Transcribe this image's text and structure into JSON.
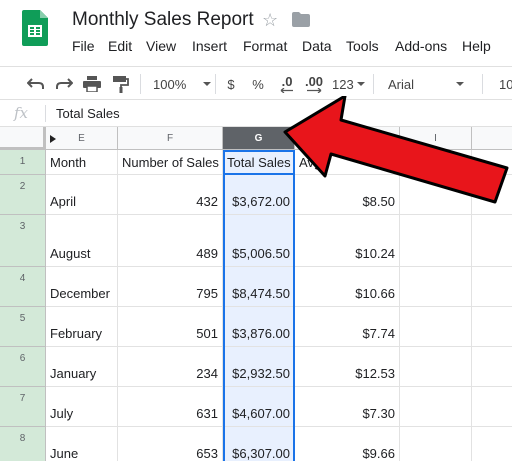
{
  "header": {
    "title": "Monthly Sales Report",
    "menu": [
      "File",
      "Edit",
      "View",
      "Insert",
      "Format",
      "Data",
      "Tools",
      "Add-ons",
      "Help"
    ]
  },
  "toolbar": {
    "zoom": "100%",
    "currency": "$",
    "percent": "%",
    "decrease_decimals": ".0",
    "increase_decimals": ".00",
    "more_formats": "123",
    "font": "Arial",
    "font_size": "10"
  },
  "formula_bar": {
    "fx": "fx",
    "value": "Total Sales"
  },
  "grid": {
    "columns": [
      "E",
      "F",
      "G",
      "H",
      "I"
    ],
    "selected_column": "G",
    "row_numbers": [
      "1",
      "2",
      "3",
      "4",
      "5",
      "6",
      "7",
      "8"
    ],
    "headers": [
      "Month",
      "Number of Sales",
      "Total Sales",
      "Avg"
    ],
    "rows": [
      [
        "April",
        "432",
        "$3,672.00",
        "$8.50"
      ],
      [
        "August",
        "489",
        "$5,006.50",
        "$10.24"
      ],
      [
        "December",
        "795",
        "$8,474.50",
        "$10.66"
      ],
      [
        "February",
        "501",
        "$3,876.00",
        "$7.74"
      ],
      [
        "January",
        "234",
        "$2,932.50",
        "$12.53"
      ],
      [
        "July",
        "631",
        "$4,607.00",
        "$7.30"
      ],
      [
        "June",
        "653",
        "$6,307.00",
        "$9.66"
      ]
    ]
  },
  "colors": {
    "sheets_green": "#0f9d58",
    "selection_blue": "#1a73e8",
    "selection_fill": "#e8f0fe",
    "row_header_green": "#d3e9d8",
    "arrow_red": "#e8151b"
  }
}
